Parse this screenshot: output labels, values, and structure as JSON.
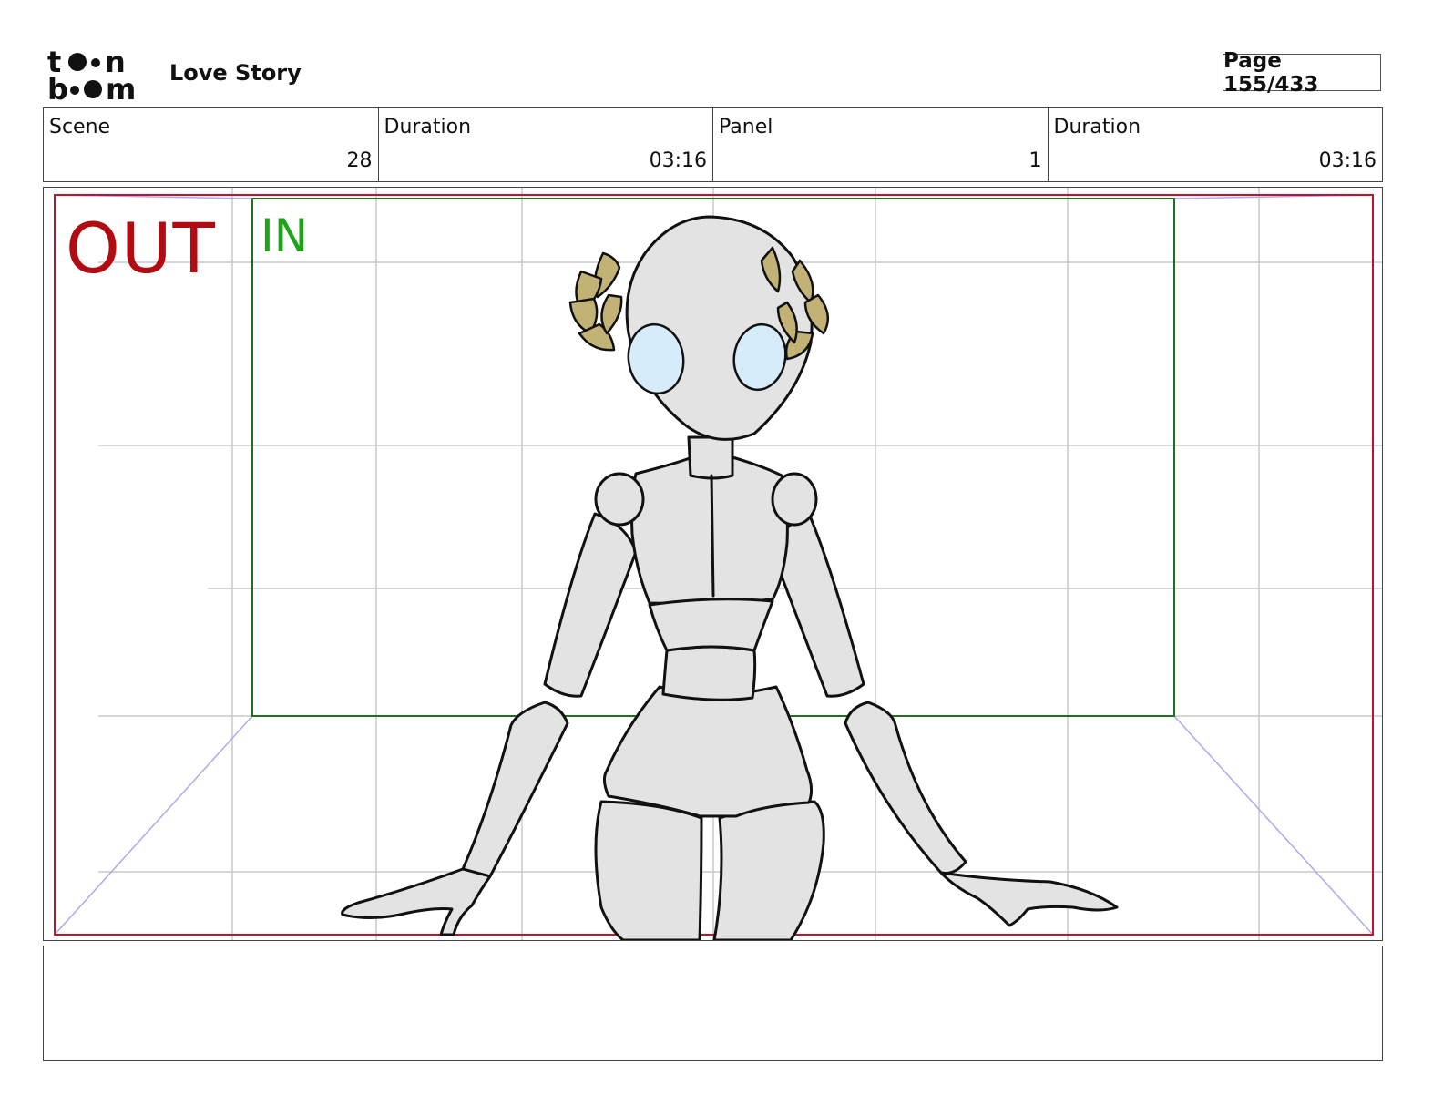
{
  "header": {
    "logo_top": "toon",
    "logo_bottom": "boom",
    "project_title": "Love Story",
    "page_label": "Page 155/433"
  },
  "info": {
    "scene_label": "Scene",
    "scene_value": "28",
    "scene_duration_label": "Duration",
    "scene_duration_value": "03:16",
    "panel_label": "Panel",
    "panel_value": "1",
    "panel_duration_label": "Duration",
    "panel_duration_value": "03:16"
  },
  "panel": {
    "out_label": "OUT",
    "in_label": "IN",
    "out_color": "#b00c12",
    "in_color": "#1ea319"
  },
  "caption": {
    "text": ""
  }
}
